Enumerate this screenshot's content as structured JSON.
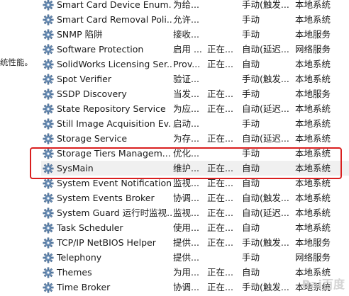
{
  "left_fragment": "统性能。",
  "services": [
    {
      "name": "Smart Card Device Enum...",
      "desc": "为给...",
      "status": "",
      "startup": "手动(触发...",
      "logon": "本地系统"
    },
    {
      "name": "Smart Card Removal Poli...",
      "desc": "允许...",
      "status": "",
      "startup": "手动",
      "logon": "本地系统"
    },
    {
      "name": "SNMP 陷阱",
      "desc": "接收...",
      "status": "",
      "startup": "手动",
      "logon": "本地服务"
    },
    {
      "name": "Software Protection",
      "desc": "启用 ...",
      "status": "正在...",
      "startup": "自动(延迟...",
      "logon": "网络服务"
    },
    {
      "name": "SolidWorks Licensing Ser...",
      "desc": "Prov...",
      "status": "正在...",
      "startup": "自动",
      "logon": "本地系统"
    },
    {
      "name": "Spot Verifier",
      "desc": "验证...",
      "status": "",
      "startup": "手动(触发...",
      "logon": "本地系统"
    },
    {
      "name": "SSDP Discovery",
      "desc": "当发...",
      "status": "正在...",
      "startup": "手动",
      "logon": "本地服务"
    },
    {
      "name": "State Repository Service",
      "desc": "为应...",
      "status": "正在...",
      "startup": "自动(延迟...",
      "logon": "本地系统"
    },
    {
      "name": "Still Image Acquisition Ev...",
      "desc": "启动...",
      "status": "",
      "startup": "手动",
      "logon": "本地系统"
    },
    {
      "name": "Storage Service",
      "desc": "为存...",
      "status": "正在...",
      "startup": "自动(延迟...",
      "logon": "本地系统"
    },
    {
      "name": "Storage Tiers Managem...",
      "desc": "优化...",
      "status": "",
      "startup": "手动",
      "logon": "本地系统"
    },
    {
      "name": "SysMain",
      "desc": "维护...",
      "status": "正在...",
      "startup": "自动",
      "logon": "本地系统"
    },
    {
      "name": "System Event Notification...",
      "desc": "监视...",
      "status": "正在...",
      "startup": "自动",
      "logon": "本地系统"
    },
    {
      "name": "System Events Broker",
      "desc": "协调...",
      "status": "正在...",
      "startup": "自动(触发...",
      "logon": "本地系统"
    },
    {
      "name": "System Guard 运行时监视...",
      "desc": "监视...",
      "status": "正在...",
      "startup": "自动(延迟...",
      "logon": "本地系统"
    },
    {
      "name": "Task Scheduler",
      "desc": "使用...",
      "status": "正在...",
      "startup": "自动",
      "logon": "本地系统"
    },
    {
      "name": "TCP/IP NetBIOS Helper",
      "desc": "提供...",
      "status": "正在...",
      "startup": "手动(触发...",
      "logon": "本地服务"
    },
    {
      "name": "Telephony",
      "desc": "提供...",
      "status": "",
      "startup": "手动",
      "logon": "网络服务"
    },
    {
      "name": "Themes",
      "desc": "为用...",
      "status": "正在...",
      "startup": "自动",
      "logon": "本地系统"
    },
    {
      "name": "Time Broker",
      "desc": "协调...",
      "status": "正在...",
      "startup": "手动(触发...",
      "logon": "本地系统"
    }
  ],
  "selected_index": 11,
  "highlight_color": "#d91f1f",
  "icon": "gear-icon",
  "watermark": "Bai百度"
}
